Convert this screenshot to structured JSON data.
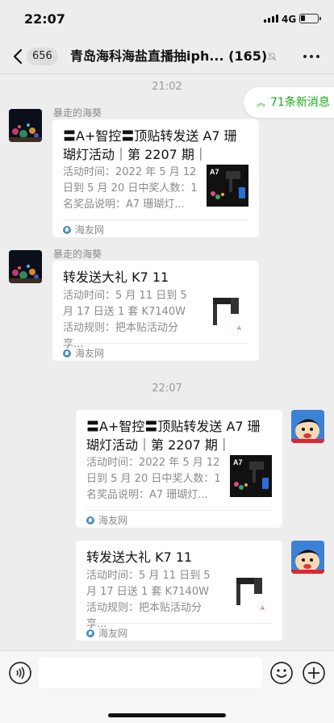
{
  "status_bar": {
    "time": "22:07",
    "network": "4G",
    "battery_level": 0.25
  },
  "nav": {
    "unread_count": "656",
    "title": "青岛海科海盐直播抽iph... (165)",
    "icons": {
      "back": "chevron-left-icon",
      "mute": "mute-icon",
      "more": "more-dots-icon"
    }
  },
  "new_messages_pill": {
    "icon": "double-chevron-up-icon",
    "label": "71条新消息",
    "color": "#1aad19"
  },
  "timestamps": [
    "21:02",
    "22:07"
  ],
  "messages": [
    {
      "sender": "暴走的海葵",
      "side": "left",
      "avatar": "dark-aquarium-avatar",
      "card": {
        "title": "〓A+智控〓顶贴转发送 A7 珊瑚灯活动｜第 2207 期｜",
        "desc": "活动时间：2022 年 5 月 12 日到 5 月 20 日中奖人数：1 名奖品说明：A7 珊瑚灯...",
        "thumb": "a7-coral-light-thumbnail",
        "thumb_label": "A7",
        "source": "海友网"
      }
    },
    {
      "sender": "暴走的海葵",
      "side": "left",
      "avatar": "dark-aquarium-avatar",
      "card": {
        "title": "转发送大礼 K7 11",
        "desc": "活动时间：5 月 11 日到 5 月 17 日送 1 套 K7140W 活动规则：把本贴活动分享...",
        "thumb": "k7-light-thumbnail",
        "source": "海友网"
      }
    },
    {
      "side": "right",
      "avatar": "cartoon-kid-avatar",
      "card": {
        "title": "〓A+智控〓顶贴转发送 A7 珊瑚灯活动｜第 2207 期｜",
        "desc": "活动时间：2022 年 5 月 12 日到 5 月 20 日中奖人数：1 名奖品说明：A7 珊瑚灯...",
        "thumb": "a7-coral-light-thumbnail",
        "thumb_label": "A7",
        "source": "海友网"
      }
    },
    {
      "side": "right",
      "avatar": "cartoon-kid-avatar",
      "card": {
        "title": "转发送大礼 K7 11",
        "desc": "活动时间：5 月 11 日到 5 月 17 日送 1 套 K7140W 活动规则：把本贴活动分享...",
        "thumb": "k7-light-thumbnail",
        "source": "海友网"
      }
    }
  ],
  "input_bar": {
    "icons": {
      "voice": "voice-icon",
      "emoji": "emoji-icon",
      "plus": "plus-icon"
    }
  }
}
